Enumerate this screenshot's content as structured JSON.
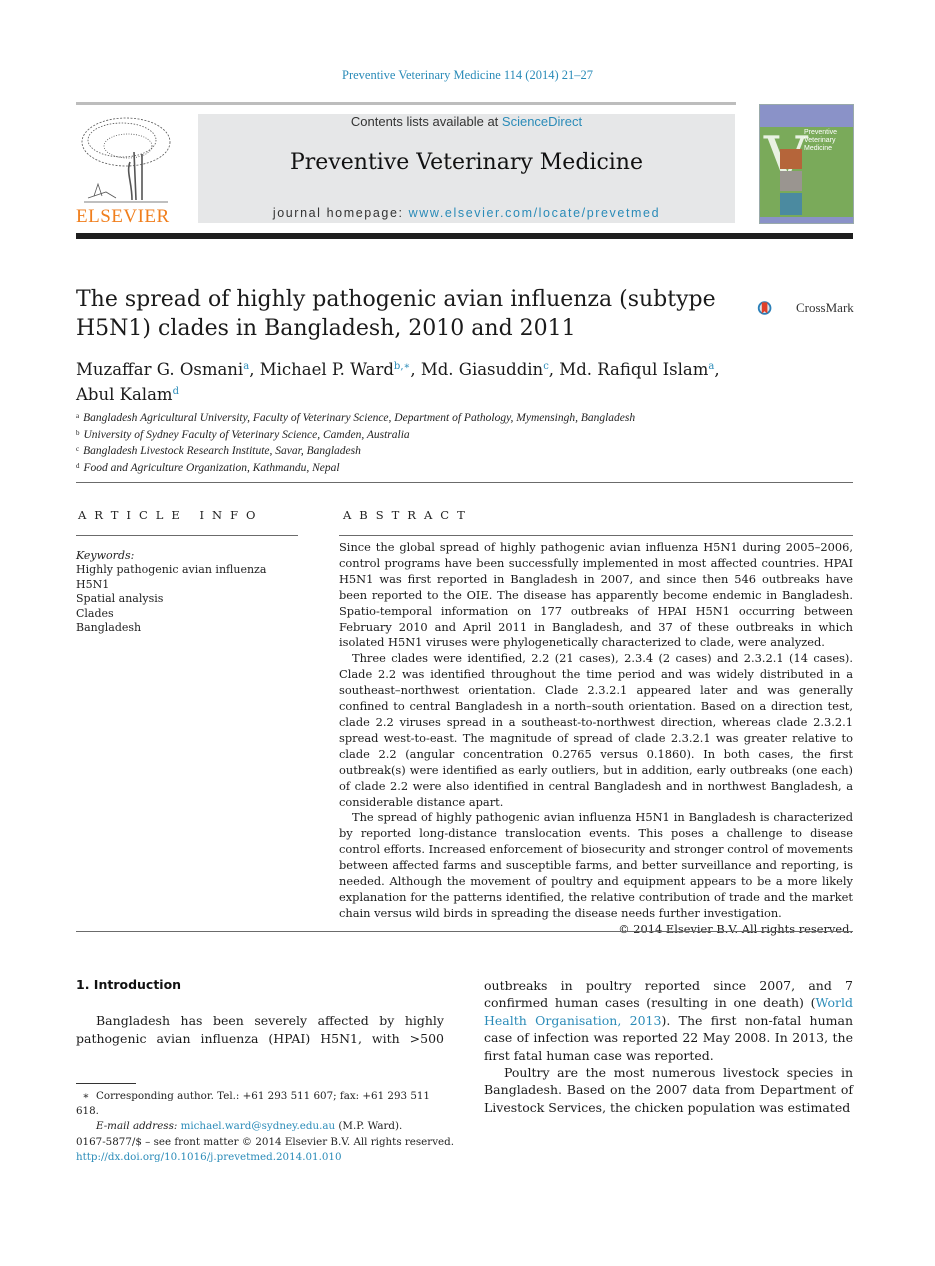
{
  "running_head": "Preventive Veterinary Medicine 114 (2014) 21–27",
  "header": {
    "publisher_logo_text": "ELSEVIER",
    "contents_prefix": "Contents lists available at ",
    "contents_link": "ScienceDirect",
    "journal_title": "Preventive Veterinary Medicine",
    "homepage_prefix": "journal homepage: ",
    "homepage_link": "www.elsevier.com/locate/prevetmed",
    "cover_title": "Preventive Veterinary Medicine",
    "accent_color": "#2a8bb8",
    "logo_color": "#f07e1c"
  },
  "article": {
    "title": "The spread of highly pathogenic avian influenza (subtype H5N1) clades in Bangladesh, 2010 and 2011",
    "crossmark_label": "CrossMark",
    "authors": [
      {
        "name": "Muzaffar G. Osmani",
        "sup": "a",
        "sep": ", "
      },
      {
        "name": "Michael P. Ward",
        "sup": "b,∗",
        "sep": ", "
      },
      {
        "name": "Md. Giasuddin",
        "sup": "c",
        "sep": ", "
      },
      {
        "name": "Md. Rafiqul Islam",
        "sup": "a",
        "sep": ","
      },
      {
        "name": "Abul Kalam",
        "sup": "d",
        "sep": ""
      }
    ],
    "affiliations": [
      {
        "key": "a",
        "text": "Bangladesh Agricultural University, Faculty of Veterinary Science, Department of Pathology, Mymensingh, Bangladesh"
      },
      {
        "key": "b",
        "text": "University of Sydney Faculty of Veterinary Science, Camden, Australia"
      },
      {
        "key": "c",
        "text": "Bangladesh Livestock Research Institute, Savar, Bangladesh"
      },
      {
        "key": "d",
        "text": "Food and Agriculture Organization, Kathmandu, Nepal"
      }
    ]
  },
  "article_info": {
    "heading": "ARTICLE INFO",
    "keywords_label": "Keywords:",
    "keywords": [
      "Highly pathogenic avian influenza",
      "H5N1",
      "Spatial analysis",
      "Clades",
      "Bangladesh"
    ]
  },
  "abstract": {
    "heading": "ABSTRACT",
    "paragraphs": [
      "Since the global spread of highly pathogenic avian influenza H5N1 during 2005–2006, control programs have been successfully implemented in most affected countries. HPAI H5N1 was first reported in Bangladesh in 2007, and since then 546 outbreaks have been reported to the OIE. The disease has apparently become endemic in Bangladesh. Spatio-temporal information on 177 outbreaks of HPAI H5N1 occurring between February 2010 and April 2011 in Bangladesh, and 37 of these outbreaks in which isolated H5N1 viruses were phylogenetically characterized to clade, were analyzed.",
      "Three clades were identified, 2.2 (21 cases), 2.3.4 (2 cases) and 2.3.2.1 (14 cases). Clade 2.2 was identified throughout the time period and was widely distributed in a southeast–northwest orientation. Clade 2.3.2.1 appeared later and was generally confined to central Bangladesh in a north–south orientation. Based on a direction test, clade 2.2 viruses spread in a southeast-to-northwest direction, whereas clade 2.3.2.1 spread west-to-east. The magnitude of spread of clade 2.3.2.1 was greater relative to clade 2.2 (angular concentration 0.2765 versus 0.1860). In both cases, the first outbreak(s) were identified as early outliers, but in addition, early outbreaks (one each) of clade 2.2 were also identified in central Bangladesh and in northwest Bangladesh, a considerable distance apart.",
      "The spread of highly pathogenic avian influenza H5N1 in Bangladesh is characterized by reported long-distance translocation events. This poses a challenge to disease control efforts. Increased enforcement of biosecurity and stronger control of movements between affected farms and susceptible farms, and better surveillance and reporting, is needed. Although the movement of poultry and equipment appears to be a more likely explanation for the patterns identified, the relative contribution of trade and the market chain versus wild birds in spreading the disease needs further investigation."
    ],
    "copyright": "© 2014 Elsevier B.V. All rights reserved."
  },
  "body": {
    "intro_heading": "1.  Introduction",
    "left_paragraph": "Bangladesh has been severely affected by highly pathogenic avian influenza (HPAI) H5N1, with >500",
    "right_p1_before": "outbreaks in poultry reported since 2007, and 7 confirmed human cases (resulting in one death) (",
    "right_p1_link": "World Health Organisation, 2013",
    "right_p1_after": "). The first non-fatal human case of infection was reported 22 May 2008. In 2013, the first fatal human case was reported.",
    "right_p2": "Poultry are the most numerous livestock species in Bangladesh. Based on the 2007 data from Department of Livestock Services, the chicken population was estimated"
  },
  "footnotes": {
    "star": "∗",
    "corresponding": "Corresponding author. Tel.: +61 293 511 607; fax: +61 293 511 618.",
    "email_label": "E-mail address:",
    "email": "michael.ward@sydney.edu.au",
    "email_suffix": " (M.P. Ward).",
    "front_matter": "0167-5877/$ – see front matter © 2014 Elsevier B.V. All rights reserved.",
    "doi": "http://dx.doi.org/10.1016/j.prevetmed.2014.01.010"
  }
}
